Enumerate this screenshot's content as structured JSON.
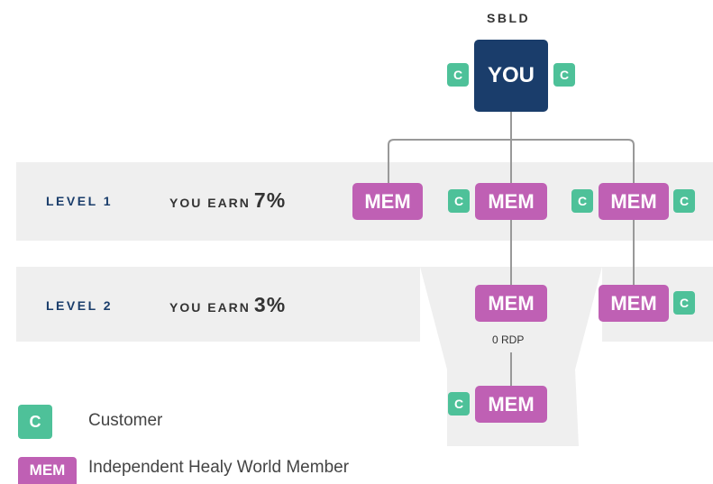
{
  "title": "SBLD",
  "you_label": "YOU",
  "customer_short": "C",
  "member_short": "MEM",
  "levels": [
    {
      "label": "LEVEL 1",
      "earn_text": "YOU EARN",
      "earn_pct": "7%"
    },
    {
      "label": "LEVEL 2",
      "earn_text": "YOU EARN",
      "earn_pct": "3%"
    }
  ],
  "rdp_label": "0 RDP",
  "legend": {
    "customer_label": "Customer",
    "member_label": "Independent Healy World Member"
  },
  "colors": {
    "navy": "#1a3d6b",
    "member": "#bf60b4",
    "customer": "#4ec199",
    "band": "#efefef",
    "connector": "#999999"
  }
}
